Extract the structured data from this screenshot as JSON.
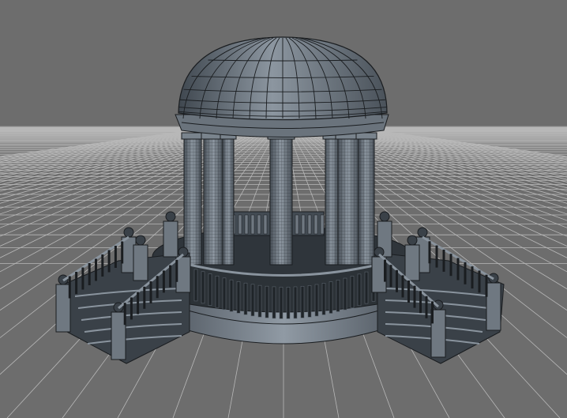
{
  "scene": {
    "colors": {
      "background": "#6d6d6d",
      "grid": "#b8b8b8",
      "horizon": "#9a9a9a",
      "model_fill": "#5d6670",
      "model_dark": "#2f353b",
      "model_light": "#8a949e",
      "wire": "#1a1d20"
    }
  }
}
